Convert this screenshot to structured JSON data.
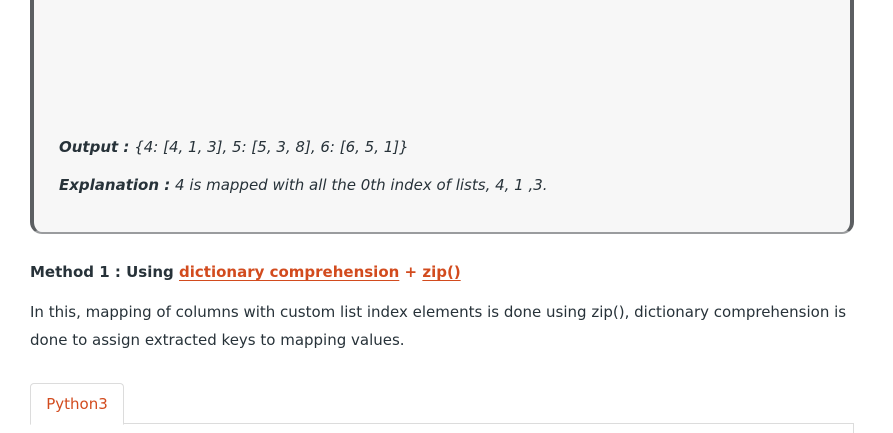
{
  "example": {
    "output_label": "Output :",
    "output_value": "{4: [4, 1, 3], 5: [5, 3, 8], 6: [6, 5, 1]}",
    "explanation_label": "Explanation :",
    "explanation_value": "4 is mapped with all the 0th index of lists, 4, 1 ,3."
  },
  "method": {
    "prefix": "Method 1 : Using",
    "link1": "dictionary comprehension",
    "plus": "+",
    "link2": "zip()"
  },
  "paragraph": "In this, mapping of columns with custom list index elements is done using zip(), dictionary comprehension is done to assign extracted keys to mapping values.",
  "tabs": [
    {
      "label": "Python3"
    }
  ],
  "colors": {
    "link": "#d24b1e",
    "text": "#273239",
    "box_bg": "#f7f7f7",
    "box_border": "#5c5f62"
  }
}
